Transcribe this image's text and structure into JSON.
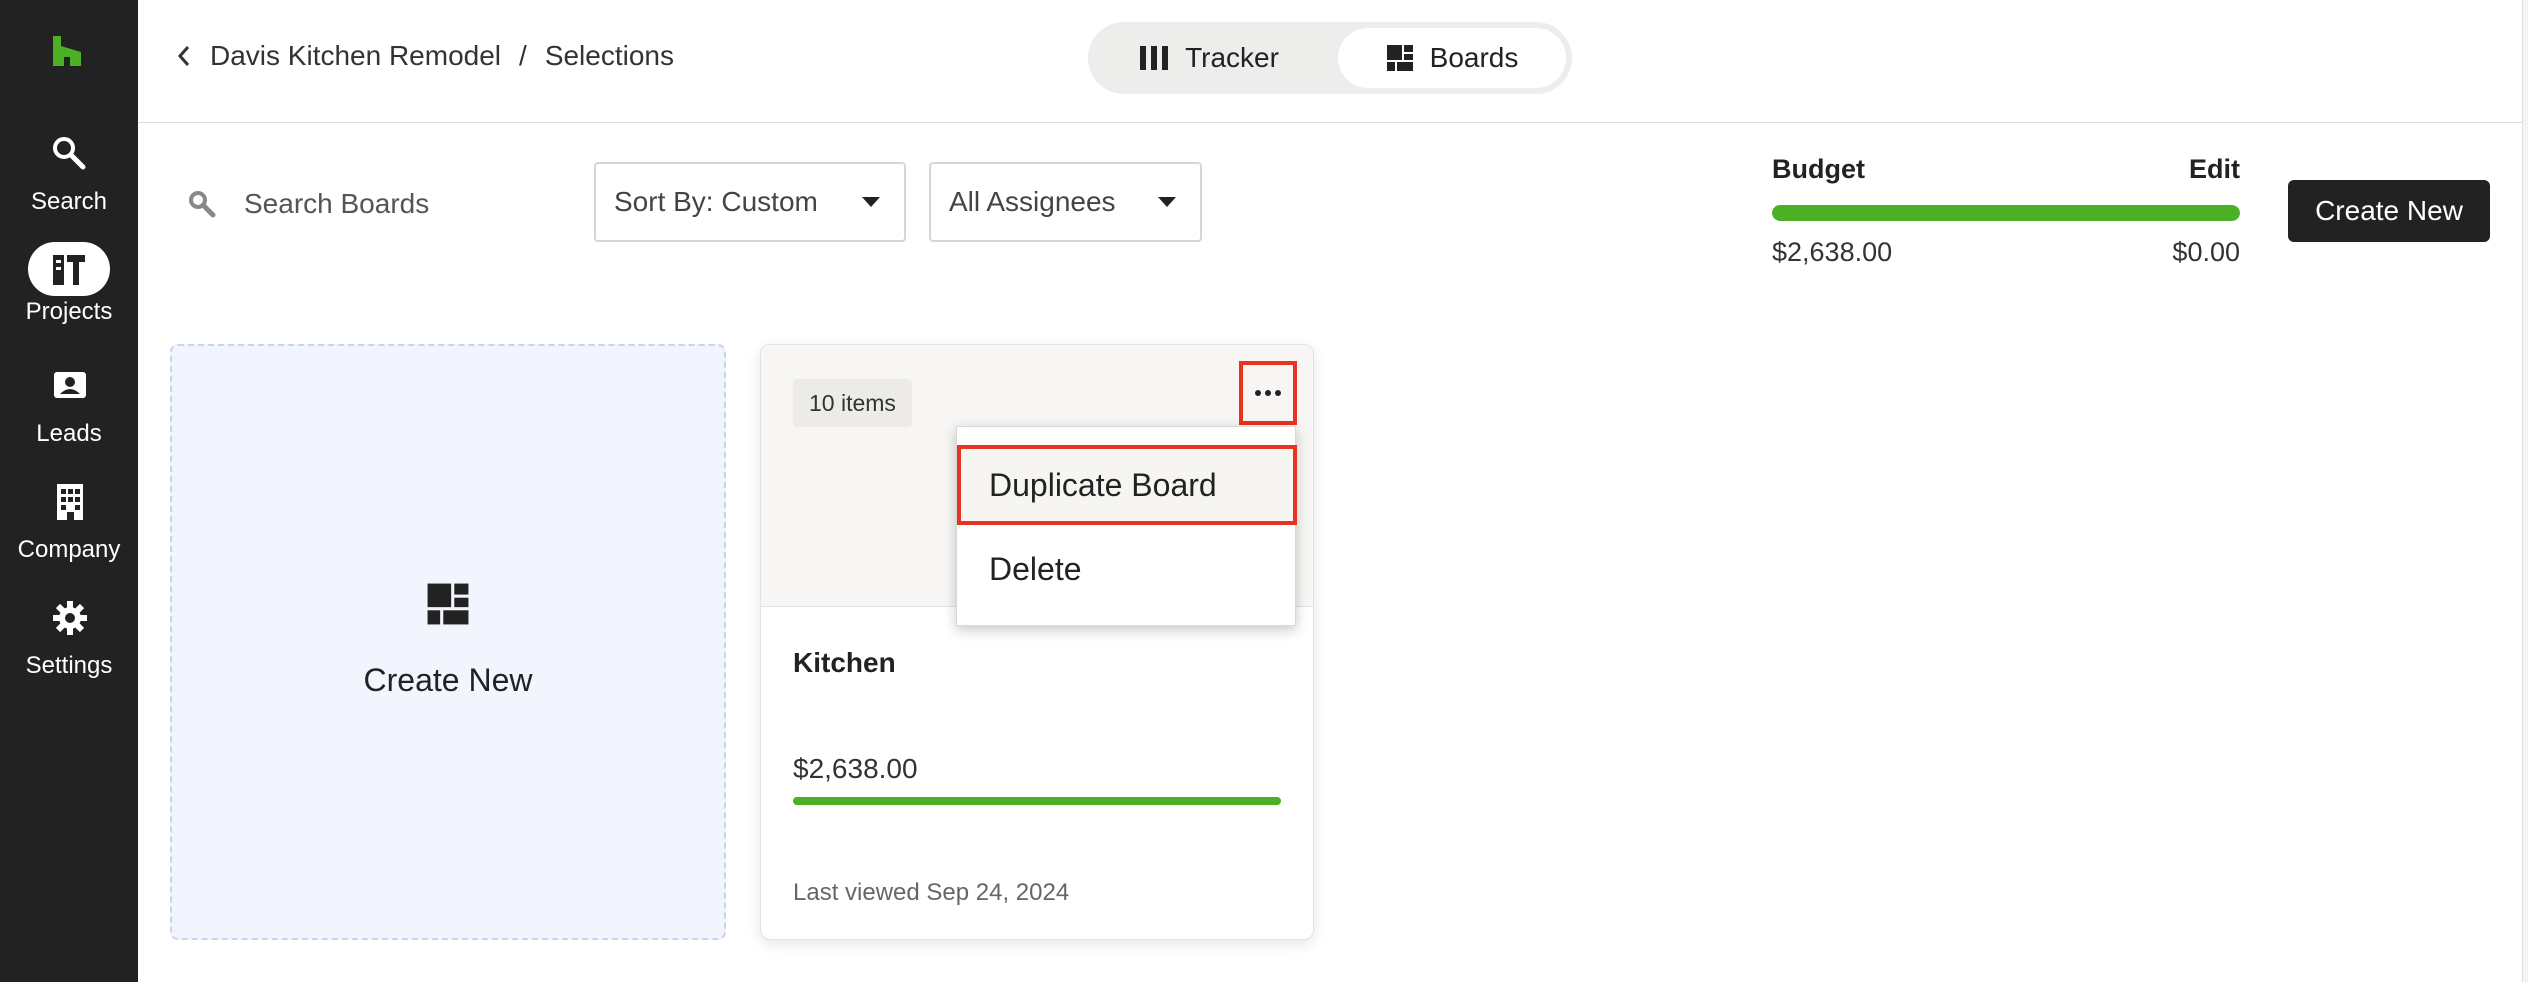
{
  "sidebar": {
    "items": [
      {
        "label": "Search",
        "icon": "search-icon"
      },
      {
        "label": "Projects",
        "icon": "projects-icon",
        "active": true
      },
      {
        "label": "Leads",
        "icon": "leads-icon"
      },
      {
        "label": "Company",
        "icon": "company-icon"
      },
      {
        "label": "Settings",
        "icon": "gear-icon"
      }
    ]
  },
  "header": {
    "breadcrumb": {
      "project": "Davis Kitchen Remodel",
      "separator": "/",
      "current": "Selections"
    },
    "views": {
      "tracker": "Tracker",
      "boards": "Boards",
      "active": "Boards"
    }
  },
  "toolbar": {
    "search_placeholder": "Search Boards",
    "sort_label": "Sort By: Custom",
    "assignees_label": "All Assignees",
    "create_button": "Create New"
  },
  "budget": {
    "title": "Budget",
    "edit_label": "Edit",
    "spent": "$2,638.00",
    "remaining": "$0.00",
    "fill_percent": 100
  },
  "create_card": {
    "label": "Create New"
  },
  "board": {
    "items_count": "10 items",
    "title": "Kitchen",
    "amount": "$2,638.00",
    "last_viewed": "Last viewed Sep 24, 2024"
  },
  "menu": {
    "items": [
      "Duplicate Board",
      "Delete"
    ]
  },
  "colors": {
    "sidebar": "#222222",
    "accent_green": "#4cb024",
    "highlight_red": "#e8331f",
    "logo_green": "#4cb024"
  }
}
